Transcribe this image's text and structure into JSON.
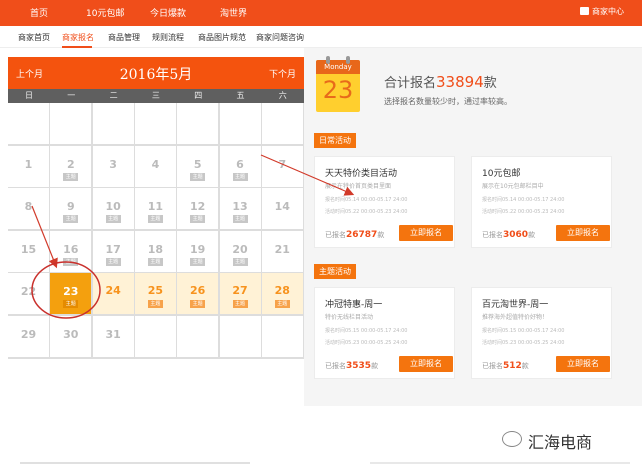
{
  "top_nav": {
    "items": [
      "首页",
      "10元包邮",
      "今日爆款",
      "淘世界"
    ],
    "merchant_center": "商家中心"
  },
  "sub_nav": {
    "items": [
      "商家首页",
      "商家报名",
      "商品管理",
      "规则流程",
      "商品图片规范",
      "商家问题咨询"
    ],
    "active_index": 1
  },
  "calendar": {
    "prev_label": "上个月",
    "next_label": "下个月",
    "month_title": "2016年5月",
    "weekdays": [
      "日",
      "一",
      "二",
      "三",
      "四",
      "五",
      "六"
    ],
    "tag_label": "主题",
    "today": "23",
    "rows": [
      [
        {
          "d": ""
        },
        {
          "d": ""
        },
        {
          "d": ""
        },
        {
          "d": ""
        },
        {
          "d": ""
        },
        {
          "d": ""
        },
        {
          "d": ""
        }
      ],
      [
        {
          "d": "1"
        },
        {
          "d": "2",
          "t": true
        },
        {
          "d": "3"
        },
        {
          "d": "4"
        },
        {
          "d": "5",
          "t": true
        },
        {
          "d": "6",
          "t": true
        },
        {
          "d": "7"
        }
      ],
      [
        {
          "d": "8"
        },
        {
          "d": "9",
          "t": true
        },
        {
          "d": "10",
          "t": true
        },
        {
          "d": "11",
          "t": true
        },
        {
          "d": "12",
          "t": true
        },
        {
          "d": "13",
          "t": true
        },
        {
          "d": "14"
        }
      ],
      [
        {
          "d": "15"
        },
        {
          "d": "16",
          "t": true
        },
        {
          "d": "17",
          "t": true
        },
        {
          "d": "18",
          "t": true
        },
        {
          "d": "19",
          "t": true
        },
        {
          "d": "20",
          "t": true
        },
        {
          "d": "21"
        }
      ],
      [
        {
          "d": "22"
        },
        {
          "d": "23",
          "t": true,
          "today": true
        },
        {
          "d": "24",
          "hl": true
        },
        {
          "d": "25",
          "t": true,
          "hl": true
        },
        {
          "d": "26",
          "t": true,
          "hl": true
        },
        {
          "d": "27",
          "t": true,
          "hl": true
        },
        {
          "d": "28",
          "t": true,
          "hl": true
        }
      ],
      [
        {
          "d": "29"
        },
        {
          "d": "30"
        },
        {
          "d": "31"
        },
        {
          "d": ""
        },
        {
          "d": ""
        },
        {
          "d": ""
        },
        {
          "d": ""
        }
      ]
    ]
  },
  "date_icon": {
    "weekday": "Monday",
    "day": "23"
  },
  "summary": {
    "prefix": "合计报名",
    "total": "33894",
    "unit": "款",
    "hint": "选择报名数量较少时，通过率较高。"
  },
  "sections": {
    "daily": "日常活动",
    "theme": "主题活动"
  },
  "cards": [
    {
      "title": "天天特价类目活动",
      "sub": "展示在特价首页类目里面",
      "reg_time": "报名时间05.14 00:00-05.17 24:00",
      "act_time": "活动时间05.22 00:00-05.23 24:00",
      "count_prefix": "已报名",
      "count": "26787",
      "count_suffix": "款",
      "button": "立即报名"
    },
    {
      "title": "10元包邮",
      "sub": "展示在10元包邮栏目中",
      "reg_time": "报名时间05.14 00:00-05.17 24:00",
      "act_time": "活动时间05.22 00:00-05.23 24:00",
      "count_prefix": "已报名",
      "count": "3060",
      "count_suffix": "款",
      "button": "立即报名"
    },
    {
      "title": "冲冠特惠-周一",
      "sub": "特价无线栏目活动",
      "reg_time": "报名时间05.15 00:00-05.17 24:00",
      "act_time": "活动时间05.23 00:00-05.25 24:00",
      "count_prefix": "已报名",
      "count": "3535",
      "count_suffix": "款",
      "button": "立即报名"
    },
    {
      "title": "百元淘世界-周一",
      "sub": "推荐海外超值特价好物！",
      "reg_time": "报名时间05.15 00:00-05.17 24:00",
      "act_time": "活动时间05.23 00:00-05.25 24:00",
      "count_prefix": "已报名",
      "count": "512",
      "count_suffix": "款",
      "button": "立即报名"
    }
  ],
  "brand": {
    "name": "汇海电商"
  },
  "colors": {
    "primary": "#f04e1a",
    "accent": "#f4740e",
    "highlight": "#f4a00e"
  }
}
